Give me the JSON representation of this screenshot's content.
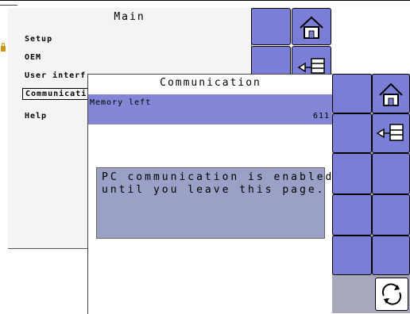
{
  "main": {
    "title": "Main",
    "items": [
      {
        "label": "Setup"
      },
      {
        "label": "OEM"
      },
      {
        "label": "User interf"
      },
      {
        "label": "Communicati"
      },
      {
        "label": "Help"
      }
    ]
  },
  "communication": {
    "title": "Communication",
    "memory_label": "Memory left",
    "memory_value": "611",
    "message": "PC communication is enabled\nuntil you leave this page."
  },
  "icons": {
    "home": "home-icon",
    "back": "back-list-icon",
    "refresh": "refresh-icon",
    "lock": "lock-icon"
  },
  "colors": {
    "button": "#7b7ed6",
    "selection": "#8286d4",
    "message_box": "#9aa0c6"
  }
}
